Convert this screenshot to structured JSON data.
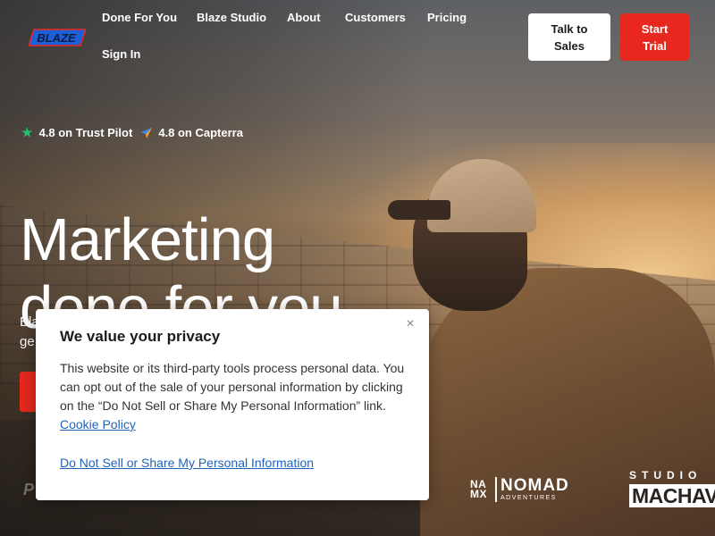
{
  "header": {
    "logo_text": "BLAZE",
    "nav": [
      {
        "label": "Done For You"
      },
      {
        "label": "Blaze Studio"
      },
      {
        "label": "About"
      },
      {
        "label": "Customers"
      },
      {
        "label": "Pricing"
      },
      {
        "label": "Sign In"
      }
    ],
    "talk_to_sales": "Talk to Sales",
    "start_trial": "Start Trial"
  },
  "ratings": {
    "trustpilot": "4.8 on Trust Pilot",
    "capterra": "4.8 on Capterra"
  },
  "hero": {
    "title_line1": "Marketing",
    "title_line2": "done for you",
    "subtitle_line1": "Bla",
    "subtitle_line2": "ge",
    "partner_faint": "P"
  },
  "customers": {
    "nomad_mark": "NA MX",
    "nomad_word": "NOMAD",
    "nomad_small": "ADVENTURES",
    "studio_top": "STUDIO",
    "studio_bottom": "MACHAVE"
  },
  "privacy_modal": {
    "title": "We value your privacy",
    "body": "This website or its third-party tools process personal data. You can opt out of the sale of your personal information by clicking on the “Do Not Sell or Share My Personal Information” link.",
    "cookie_policy_link": "Cookie Policy",
    "opt_out_link": "Do Not Sell or Share My Personal Information",
    "close_symbol": "×"
  },
  "colors": {
    "brand_red": "#e8281e",
    "trustpilot_green": "#1fbf6e",
    "link_blue": "#1f63b8"
  }
}
